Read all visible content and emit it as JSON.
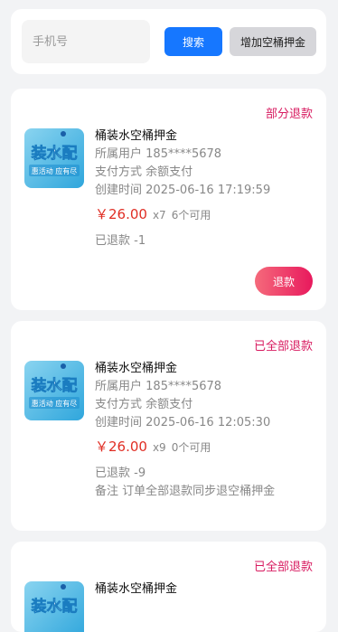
{
  "search": {
    "placeholder": "手机号",
    "search_label": "搜索",
    "add_label": "增加空桶押金"
  },
  "colors": {
    "primary": "#1677ff",
    "status": "#d81b60",
    "price": "#e02e24"
  },
  "orders": [
    {
      "status": "部分退款",
      "image_text": "装水配",
      "image_subtext": "惠活动 应有尽",
      "title": "桶装水空桶押金",
      "user_label": "所属用户",
      "user": "185****5678",
      "payment_label": "支付方式",
      "payment": "余额支付",
      "created_label": "创建时间",
      "created": "2025-06-16 17:19:59",
      "price": "￥26.00",
      "qty": "x7",
      "available": "6个可用",
      "refunded": "已退款 -1",
      "refund_button": "退款"
    },
    {
      "status": "已全部退款",
      "image_text": "装水配",
      "image_subtext": "惠活动 应有尽",
      "title": "桶装水空桶押金",
      "user_label": "所属用户",
      "user": "185****5678",
      "payment_label": "支付方式",
      "payment": "余额支付",
      "created_label": "创建时间",
      "created": "2025-06-16 12:05:30",
      "price": "￥26.00",
      "qty": "x9",
      "available": "0个可用",
      "refunded": "已退款 -9",
      "remark": "备注 订单全部退款同步退空桶押金"
    },
    {
      "status": "已全部退款",
      "image_text": "装水配",
      "title": "桶装水空桶押金"
    }
  ]
}
